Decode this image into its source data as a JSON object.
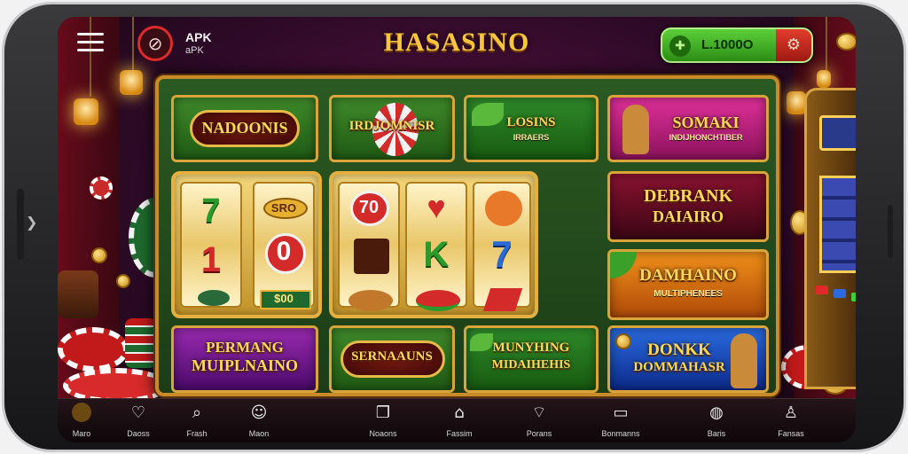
{
  "app": {
    "apk_label": "APK",
    "apk_sub": "aPK",
    "brand_title": "HASASINO",
    "balance": "L.1000O",
    "balance_icon": "coin-icon",
    "settings_icon": "gear-icon"
  },
  "games_top": [
    {
      "label": "NADOONIS"
    },
    {
      "label": "IRDJOMNISR"
    },
    {
      "label": "LOSINS",
      "sub": "IRRAERS"
    },
    {
      "label": "SOMAKI",
      "sub": "INDIJHONCHTIBER"
    }
  ],
  "games_right": [
    {
      "label": "DEBRANK",
      "sub": "DAIAIRO"
    },
    {
      "label": "DAMHAINO",
      "sub": "MULTIPHENEES"
    }
  ],
  "games_bottom": [
    {
      "label": "PERMANG",
      "sub": "MUIPLNAINO"
    },
    {
      "label": "SERNAAUNS"
    },
    {
      "label": "MUNYHING",
      "sub": "MIDAIHEHIS"
    },
    {
      "label": "DONKK",
      "sub": "DOMMAHASR"
    }
  ],
  "slot_left": {
    "reel1": [
      "7",
      "1"
    ],
    "reel2": [
      "SRO",
      "0",
      "$00"
    ]
  },
  "slot_right": {
    "reel1": [
      "70"
    ],
    "reel2": [
      "K"
    ],
    "reel3": [
      "7"
    ]
  },
  "nav": [
    {
      "label": "Maro",
      "icon": "home-coin-icon"
    },
    {
      "label": "Daoss",
      "icon": "heart-icon"
    },
    {
      "label": "Frash",
      "icon": "search-icon"
    },
    {
      "label": "Maon",
      "icon": "user-icon"
    },
    {
      "label": "Noaons",
      "icon": "grid-icon"
    },
    {
      "label": "Fassim",
      "icon": "house-icon"
    },
    {
      "label": "Porans",
      "icon": "chat-icon"
    },
    {
      "label": "Bonmanns",
      "icon": "monitor-icon"
    },
    {
      "label": "Baris",
      "icon": "globe-icon"
    },
    {
      "label": "Fansas",
      "icon": "profile-icon"
    }
  ],
  "colors": {
    "brand_gold": "#f7c540",
    "balance_green": "#3fae22",
    "accent_red": "#e33c2c"
  }
}
